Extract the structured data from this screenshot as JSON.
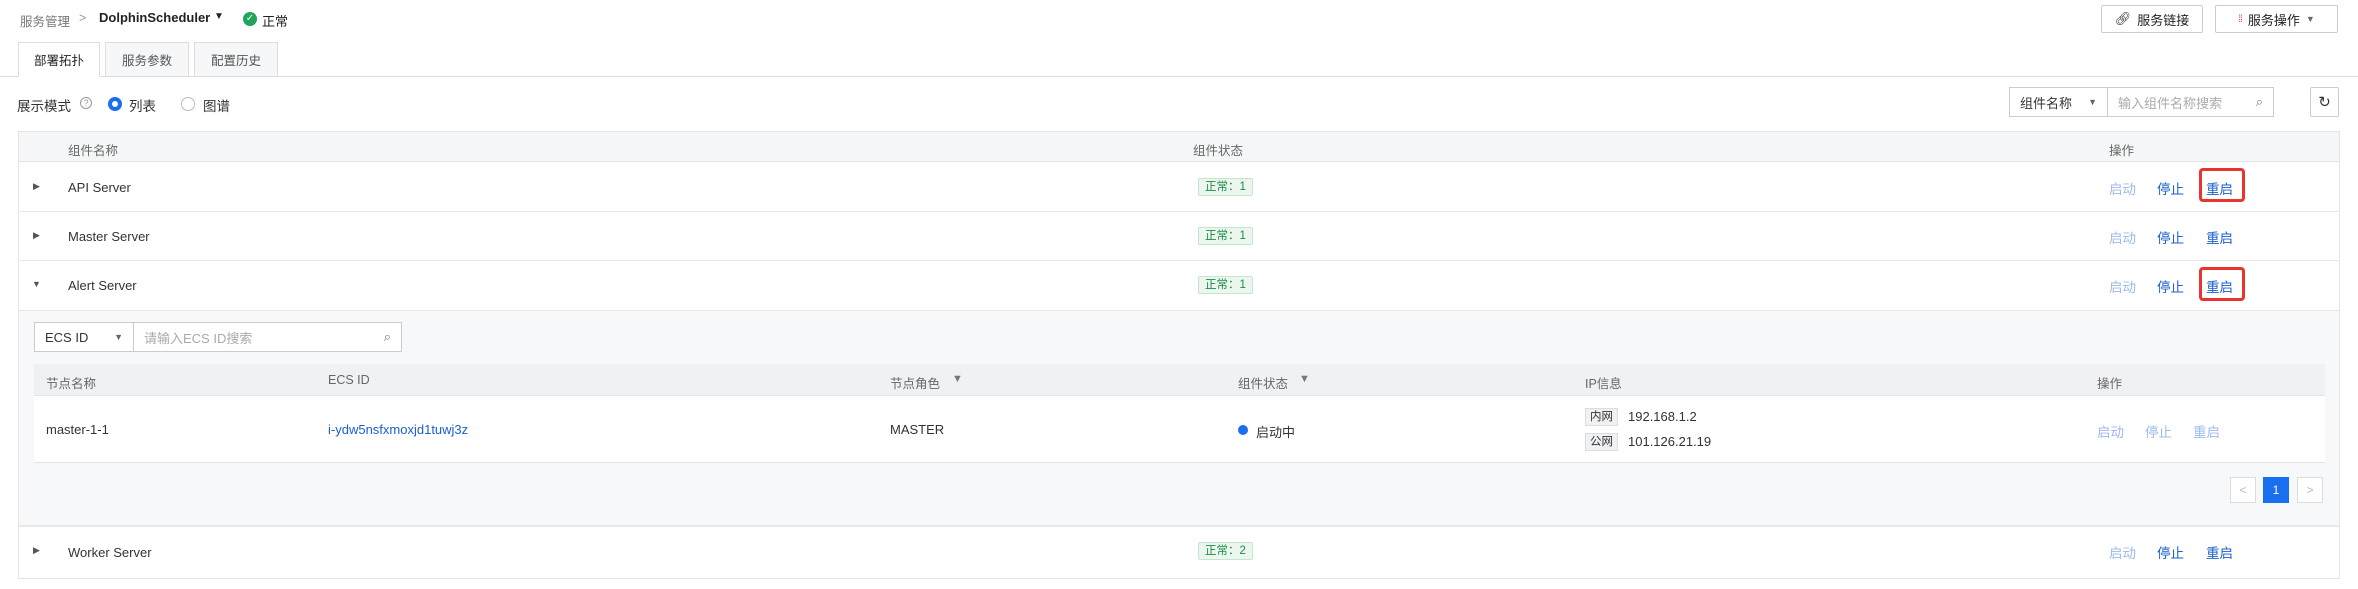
{
  "breadcrumb": {
    "root": "服务管理",
    "separator": ">",
    "service": "DolphinScheduler",
    "status": "正常"
  },
  "header_actions": {
    "service_link": "服务链接",
    "service_ops": "服务操作"
  },
  "tabs": [
    {
      "label": "部署拓扑",
      "active": true
    },
    {
      "label": "服务参数",
      "active": false
    },
    {
      "label": "配置历史",
      "active": false
    }
  ],
  "display_mode": {
    "label": "展示模式",
    "options": [
      {
        "label": "列表",
        "selected": true
      },
      {
        "label": "图谱",
        "selected": false
      }
    ]
  },
  "search": {
    "field_select": "组件名称",
    "placeholder": "输入组件名称搜索"
  },
  "table": {
    "headers": {
      "name": "组件名称",
      "status": "组件状态",
      "actions": "操作"
    },
    "rows": [
      {
        "name": "API Server",
        "status": "正常：1",
        "expanded": false
      },
      {
        "name": "Master Server",
        "status": "正常：1",
        "expanded": false
      },
      {
        "name": "Alert Server",
        "status": "正常：1",
        "expanded": true
      },
      {
        "name": "Worker Server",
        "status": "正常：2",
        "expanded": false
      }
    ],
    "actions": {
      "start": "启动",
      "stop": "停止",
      "restart": "重启"
    }
  },
  "sub_panel": {
    "filter_select": "ECS ID",
    "filter_placeholder": "请输入ECS ID搜索",
    "headers": {
      "node_name": "节点名称",
      "ecs_id": "ECS ID",
      "role": "节点角色",
      "status": "组件状态",
      "ip": "IP信息",
      "actions": "操作"
    },
    "rows": [
      {
        "node_name": "master-1-1",
        "ecs_id": "i-ydw5nsfxmoxjd1tuwj3z",
        "role": "MASTER",
        "status": "启动中",
        "ip_inner_label": "内网",
        "ip_inner": "192.168.1.2",
        "ip_public_label": "公网",
        "ip_public": "101.126.21.19"
      }
    ],
    "actions": {
      "start": "启动",
      "stop": "停止",
      "restart": "重启"
    },
    "pagination": {
      "current": "1",
      "prev": "<",
      "next": ">"
    }
  }
}
